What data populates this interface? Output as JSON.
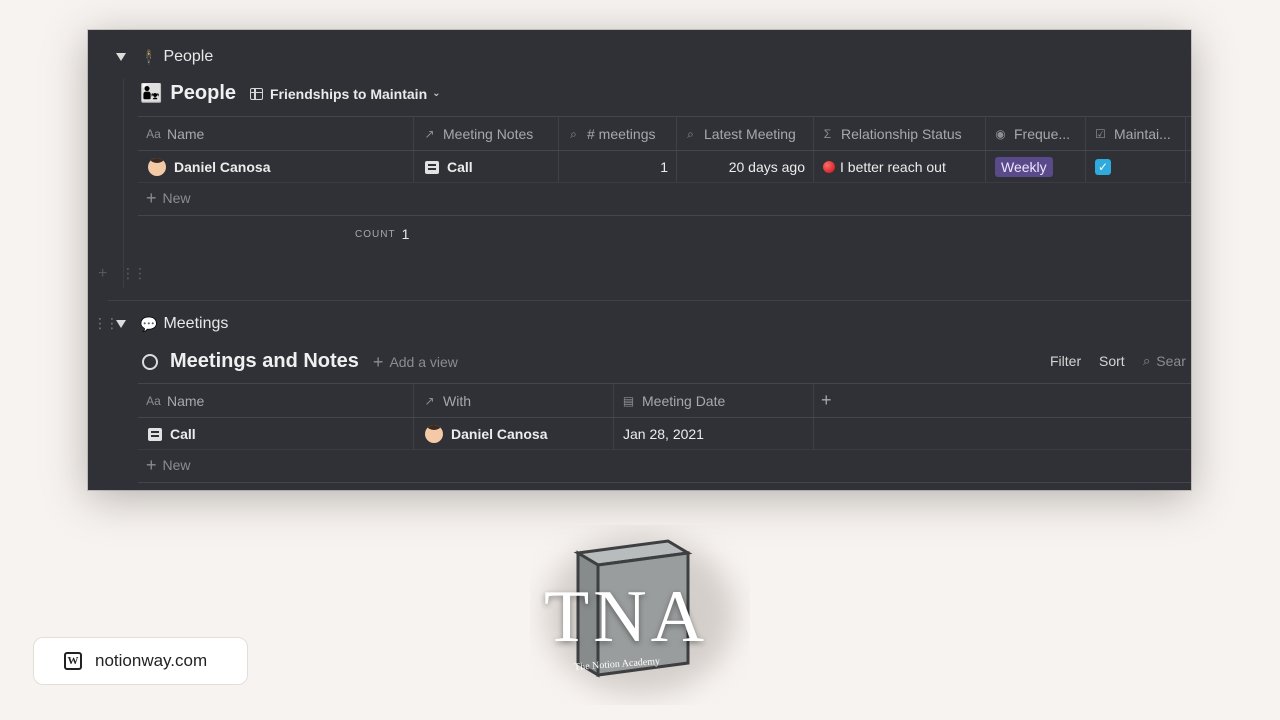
{
  "people_section": {
    "toggle_label": "People",
    "toggle_icon": "person-icon",
    "db_title": "People",
    "view_name": "Friendships to Maintain",
    "columns": [
      {
        "label": "Name",
        "icon": "text-icon"
      },
      {
        "label": "Meeting Notes",
        "icon": "relation-arrow-icon"
      },
      {
        "label": "# meetings",
        "icon": "search-icon"
      },
      {
        "label": "Latest Meeting",
        "icon": "search-icon"
      },
      {
        "label": "Relationship Status",
        "icon": "formula-icon"
      },
      {
        "label": "Freque...",
        "icon": "select-icon"
      },
      {
        "label": "Maintai...",
        "icon": "checkbox-icon"
      }
    ],
    "rows": [
      {
        "name": "Daniel Canosa",
        "meeting_notes": "Call",
        "meetings": "1",
        "latest_meeting": "20 days ago",
        "relationship_status": "I better reach out",
        "frequency": "Weekly",
        "maintain": true
      }
    ],
    "new_label": "New",
    "count_label": "COUNT",
    "count_value": "1"
  },
  "meetings_section": {
    "toggle_label": "Meetings",
    "toggle_icon": "speech-bubble-icon",
    "db_title": "Meetings and Notes",
    "add_view_label": "Add a view",
    "filter_label": "Filter",
    "sort_label": "Sort",
    "search_label": "Sear",
    "columns": [
      {
        "label": "Name",
        "icon": "text-icon"
      },
      {
        "label": "With",
        "icon": "relation-arrow-icon"
      },
      {
        "label": "Meeting Date",
        "icon": "calendar-icon"
      }
    ],
    "rows": [
      {
        "name": "Call",
        "with": "Daniel Canosa",
        "meeting_date": "Jan 28, 2021"
      }
    ],
    "new_label": "New"
  },
  "footer": {
    "site": "notionway.com",
    "logo_letter": "W"
  },
  "brand": {
    "logo_text": "TNA",
    "logo_subtitle": "The Notion Academy"
  },
  "colors": {
    "window_bg": "#2f3136",
    "page_bg": "#f7f3f0",
    "badge_purple": "#5b4a8a",
    "checkbox_blue": "#2eaadc"
  }
}
